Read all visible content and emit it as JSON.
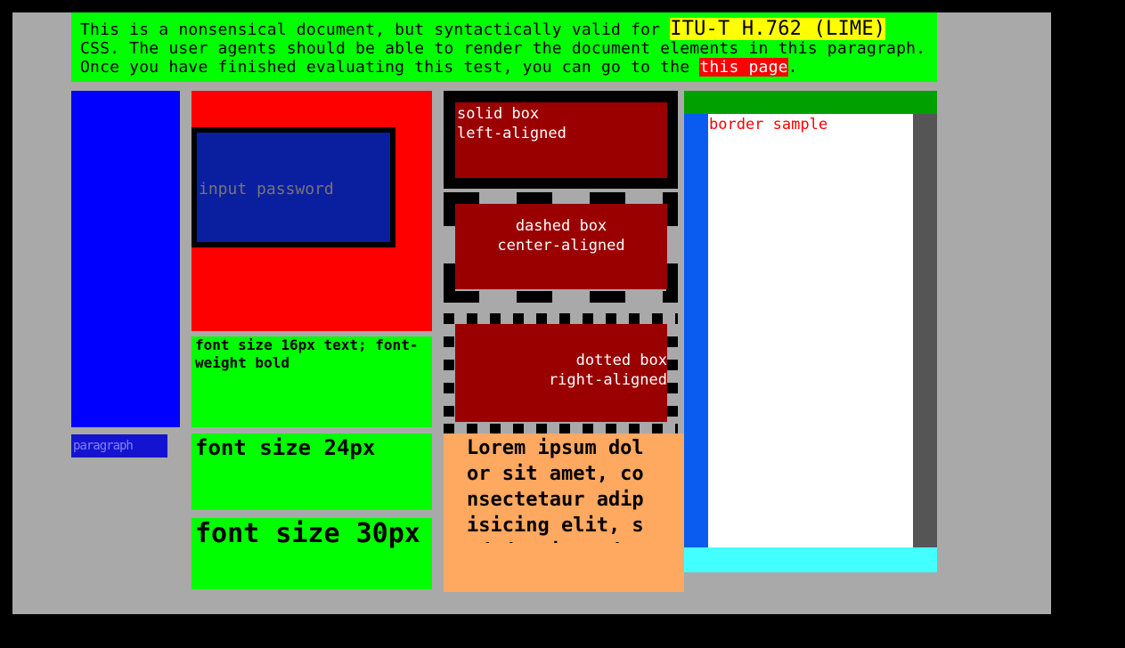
{
  "intro": {
    "text_1": "This is a nonsensical document, but syntactically valid for ",
    "highlight": "ITU-T H.762 (LIME)",
    "text_2": " CSS. The user agents should be able to render the document elements in this paragraph. Once you have finished evaluating this test, you can go to the ",
    "link": "this page",
    "text_3": "."
  },
  "paragraph_label": "paragraph",
  "password_input": {
    "placeholder": "input password"
  },
  "font_boxes": {
    "fs16": "font size 16px text; font-weight bold",
    "fs24": "font size 24px",
    "fs30": "font size 30px"
  },
  "boxes": {
    "solid": [
      "solid box",
      "left-aligned"
    ],
    "dashed": [
      "dashed box",
      "center-aligned"
    ],
    "dotted": [
      "dotted box",
      "right-aligned"
    ]
  },
  "lorem": "Lorem ipsum dolor sit amet, consectetaur adipisicing elit, sed do eiusmod",
  "border_sample": "border sample",
  "colors": {
    "background": "#a9a9a9",
    "intro_bg": "#00ff00",
    "highlight": "#ffff00",
    "link_bg": "#ff0000",
    "box_bg": "#9a0000",
    "lorem_bg": "#ffa860"
  }
}
